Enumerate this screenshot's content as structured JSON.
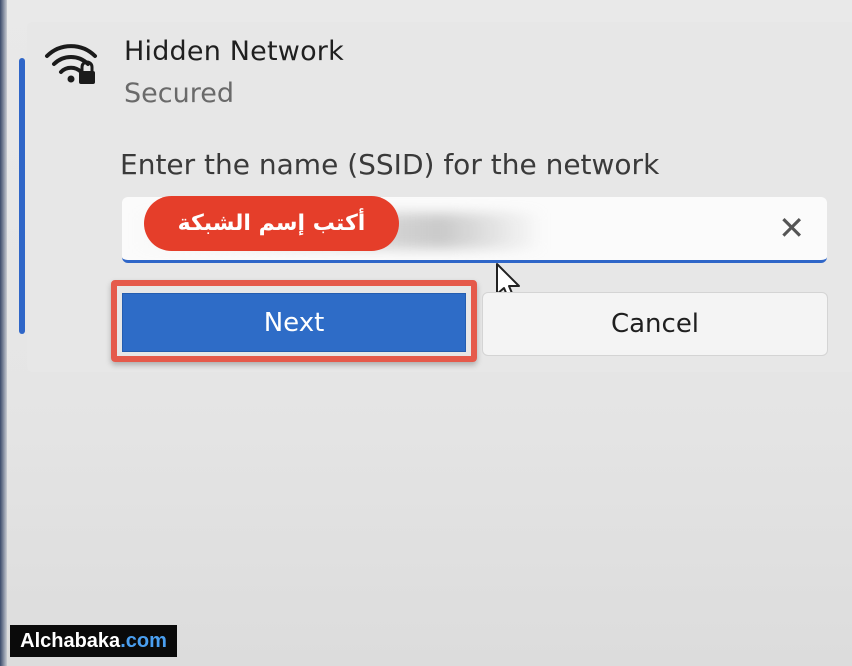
{
  "network": {
    "name": "Hidden Network",
    "status": "Secured",
    "icon": "wifi-secured-icon"
  },
  "ssid": {
    "label": "Enter the name (SSID) for the network",
    "value": "",
    "clear_glyph": "✕",
    "hint": "أكتب إسم الشبكة"
  },
  "buttons": {
    "next": "Next",
    "cancel": "Cancel"
  },
  "watermark": {
    "brand": "Alchabaka",
    "suffix": ".com"
  },
  "colors": {
    "accent": "#2e6cc7",
    "highlight": "#e55a4b",
    "hint_bg": "#e53e2a"
  }
}
